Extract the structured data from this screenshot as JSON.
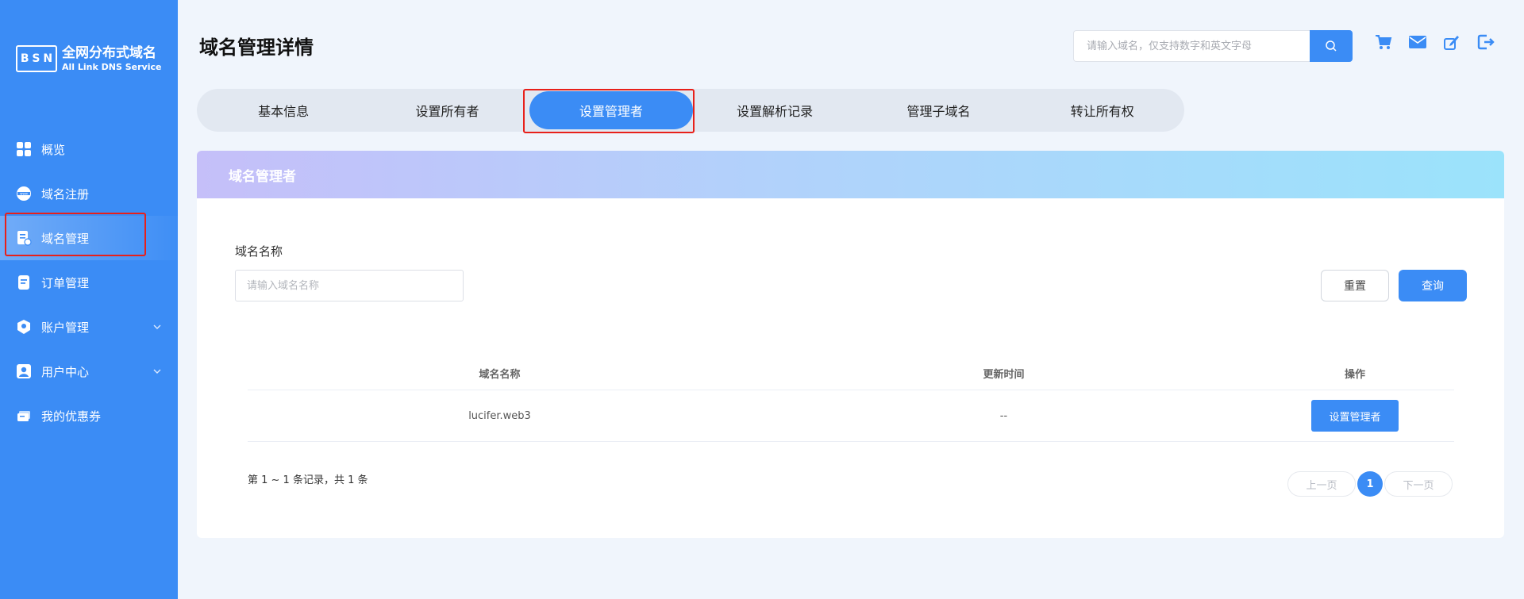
{
  "brand": {
    "logo_letters": [
      "B",
      "S",
      "N"
    ],
    "title": "全网分布式域名",
    "subtitle": "All Link DNS Service"
  },
  "sidebar": {
    "items": [
      {
        "label": "概览",
        "icon": "grid-icon"
      },
      {
        "label": "域名注册",
        "icon": "www-icon"
      },
      {
        "label": "域名管理",
        "icon": "domain-manage-icon",
        "active": true
      },
      {
        "label": "订单管理",
        "icon": "order-icon"
      },
      {
        "label": "账户管理",
        "icon": "account-icon",
        "has_chevron": true
      },
      {
        "label": "用户中心",
        "icon": "user-icon",
        "has_chevron": true
      },
      {
        "label": "我的优惠券",
        "icon": "coupon-icon"
      }
    ]
  },
  "header": {
    "title": "域名管理详情",
    "search_placeholder": "请输入域名，仅支持数字和英文字母",
    "icons": [
      "cart-icon",
      "mail-icon",
      "edit-icon",
      "logout-icon"
    ]
  },
  "tabs": [
    {
      "label": "基本信息"
    },
    {
      "label": "设置所有者"
    },
    {
      "label": "设置管理者",
      "active": true
    },
    {
      "label": "设置解析记录"
    },
    {
      "label": "管理子域名"
    },
    {
      "label": "转让所有权"
    }
  ],
  "card": {
    "title": "域名管理者",
    "field_label": "域名名称",
    "field_placeholder": "请输入域名名称",
    "reset_label": "重置",
    "query_label": "查询",
    "table": {
      "columns": [
        "域名名称",
        "更新时间",
        "操作"
      ],
      "rows": [
        {
          "domain": "lucifer.web3",
          "updated": "--",
          "action": "设置管理者"
        }
      ]
    },
    "summary": "第 1 ~ 1 条记录，共 1 条",
    "pager": {
      "prev": "上一页",
      "current": "1",
      "next": "下一页"
    }
  },
  "colors": {
    "primary": "#3b8cf5",
    "highlight": "#e8201a",
    "page_bg": "#f0f5fc"
  }
}
